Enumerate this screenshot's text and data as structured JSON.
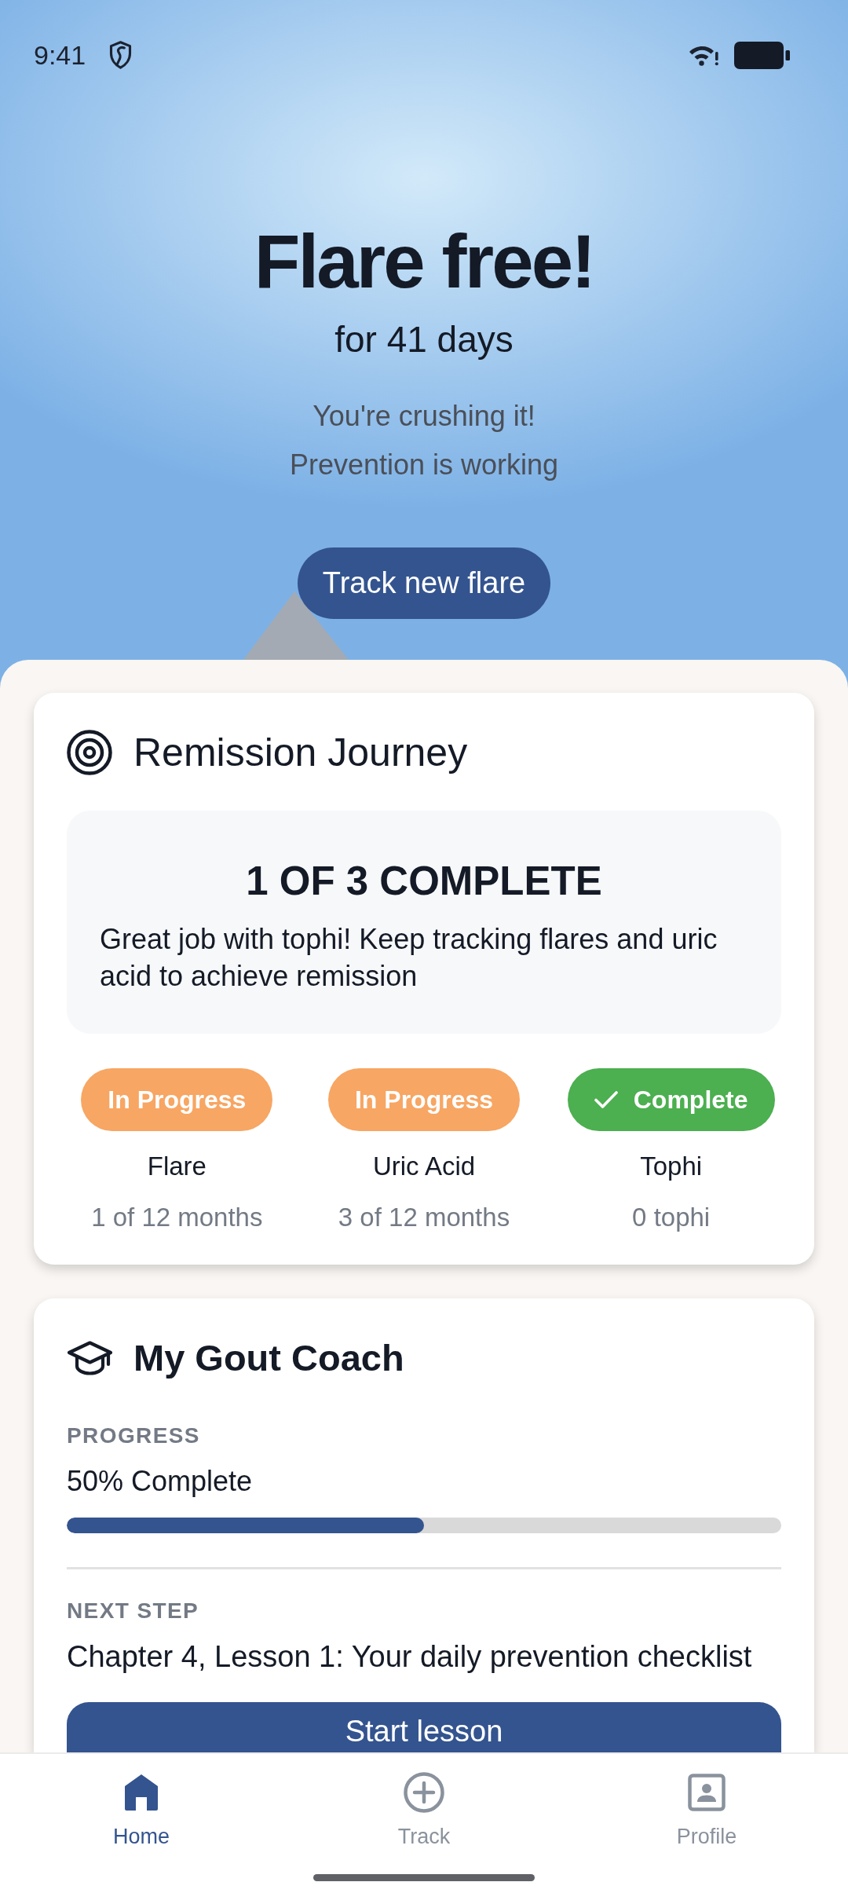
{
  "status_bar": {
    "time": "9:41"
  },
  "hero": {
    "title": "Flare free!",
    "subtitle": "for 41 days",
    "messages": [
      "You're crushing it!",
      "Prevention is working"
    ],
    "button": "Track new flare"
  },
  "remission_journey": {
    "title": "Remission Journey",
    "summary": {
      "title": "1 OF 3 COMPLETE",
      "text": "Great job with tophi! Keep tracking flares and uric acid to achieve remission"
    },
    "goals": [
      {
        "kind": "progress",
        "status": "In Progress",
        "name": "Flare",
        "detail": "1 of 12 months"
      },
      {
        "kind": "progress",
        "status": "In Progress",
        "name": "Uric Acid",
        "detail": "3 of 12 months"
      },
      {
        "kind": "complete",
        "status": "Complete",
        "name": "Tophi",
        "detail": "0 tophi"
      }
    ]
  },
  "gout_coach": {
    "title": "My Gout Coach",
    "progress_label": "PROGRESS",
    "progress_text": "50% Complete",
    "progress": {
      "level": 0.5
    },
    "next_step_label": "NEXT STEP",
    "next_step": "Chapter 4, Lesson 1: Your daily prevention checklist",
    "button": "Start lesson"
  },
  "bottom_nav": [
    {
      "label": "Home",
      "selected": true
    },
    {
      "label": "Track",
      "selected": false
    },
    {
      "label": "Profile",
      "selected": false
    }
  ]
}
